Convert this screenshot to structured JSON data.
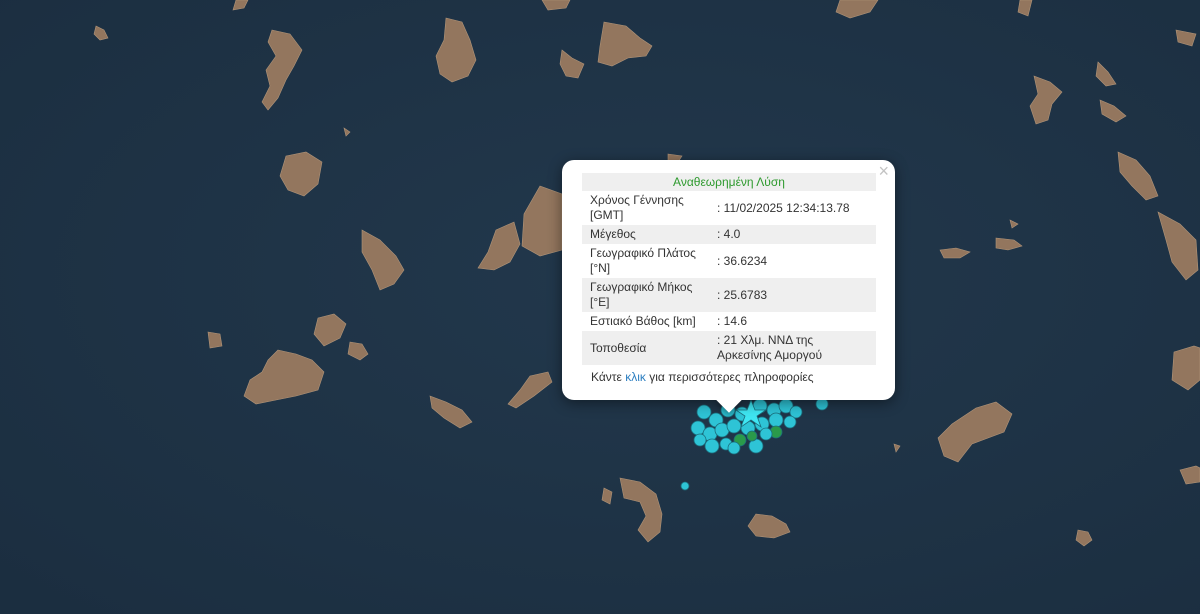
{
  "map": {
    "background_color": "#1f3346",
    "land_color": "#9a7a60",
    "event_colors": {
      "recent": "#2ec4d6",
      "older": "#2a9a4a",
      "selected_star": "#3fe6f2"
    }
  },
  "popup": {
    "close_icon": "×",
    "title": "Αναθεωρημένη Λύση",
    "rows": [
      {
        "label": "Χρόνος Γέννησης [GMT]",
        "value": ": 11/02/2025 12:34:13.78"
      },
      {
        "label": "Μέγεθος",
        "value": ": 4.0"
      },
      {
        "label": "Γεωγραφικό Πλάτος [°N]",
        "value": ": 36.6234"
      },
      {
        "label": "Γεωγραφικό Μήκος [°E]",
        "value": ": 25.6783"
      },
      {
        "label": "Εστιακό Βάθος [km]",
        "value": ": 14.6"
      },
      {
        "label": "Τοποθεσία",
        "value": ": 21 Χλμ. ΝΝΔ της Αρκεσίνης Αμοργού"
      }
    ],
    "more_prefix": "Κάντε",
    "more_link": "κλικ",
    "more_suffix": "για περισσότερες πληροφορίες"
  }
}
